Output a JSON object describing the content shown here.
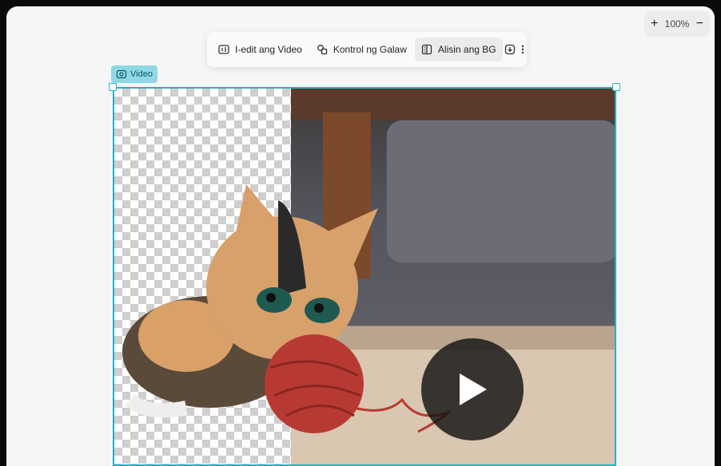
{
  "zoom": {
    "value": "100%",
    "zoom_in_icon": "plus-icon",
    "zoom_out_icon": "minus-icon"
  },
  "toolbar": {
    "items": [
      {
        "label": "I-edit ang Video",
        "icon": "edit-video-icon"
      },
      {
        "label": "Kontrol ng Galaw",
        "icon": "motion-icon"
      },
      {
        "label": "Alisin ang BG",
        "icon": "remove-bg-icon"
      }
    ],
    "download_icon": "download-icon",
    "more_icon": "more-vertical-icon"
  },
  "video": {
    "label": "Video",
    "play_icon": "play-icon"
  },
  "colors": {
    "accent": "#23b2c7",
    "label_bg": "#8fd8e6"
  }
}
